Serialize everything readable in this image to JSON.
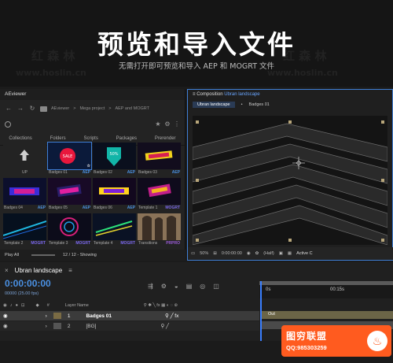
{
  "hero": {
    "title": "预览和导入文件",
    "subtitle": "无需打开即可预览和导入 AEP 和 MOGRT 文件",
    "watermark_cn": "红 森 林",
    "watermark_url": "www.hoslin.cn"
  },
  "aeviewer": {
    "title": "AEviewer",
    "breadcrumb": [
      "AEviewer",
      "Mega project",
      "AEP and MOGRT"
    ],
    "breadcrumb_sep": ">",
    "tabs": [
      "Collections",
      "Folders",
      "Scripts",
      "Packages",
      "Prerender"
    ],
    "items": [
      {
        "label": "UP",
        "tag": ""
      },
      {
        "label": "Badges 01",
        "tag": "AEP"
      },
      {
        "label": "Badges 02",
        "tag": "AEP"
      },
      {
        "label": "Badges 03",
        "tag": "AEP"
      },
      {
        "label": "Badges 04",
        "tag": "AEP"
      },
      {
        "label": "Badges 05",
        "tag": "AEP"
      },
      {
        "label": "Badges 06",
        "tag": "AEP"
      },
      {
        "label": "Template 1",
        "tag": "MOGRT"
      },
      {
        "label": "Template 2",
        "tag": "MOGRT"
      },
      {
        "label": "Template 3",
        "tag": "MOGRT"
      },
      {
        "label": "Template 4",
        "tag": "MOGRT"
      },
      {
        "label": "Transitions",
        "tag": "PRPRO"
      }
    ],
    "footer": {
      "play_all": "Play All",
      "count": "12 / 12 - Showing"
    }
  },
  "composition": {
    "title_prefix": "Composition",
    "title_name": "Ubran landscape",
    "menu_icon": "≡",
    "tabs": [
      "Ubran landscape",
      "Badges 01"
    ],
    "tab_sep": "•",
    "toolbar": {
      "zoom": "50%",
      "timecode": "0:00:00:00",
      "quality": "(Half)",
      "camera": "Active C"
    }
  },
  "timeline": {
    "comp_name": "Ubran landscape",
    "menu_icon": "≡",
    "close_icon": "×",
    "timecode": "0:00:00:00",
    "fps": "00000 (25.00 fps)",
    "ruler": [
      "0s",
      "00:15s"
    ],
    "layer_header": {
      "num": "#",
      "name": "Layer Name"
    },
    "layers": [
      {
        "num": "1",
        "name": "Badges 01",
        "color": "#7a6b44"
      },
      {
        "num": "2",
        "name": "[BG]",
        "color": "#555555"
      }
    ],
    "out_tag": "Out"
  },
  "badge": {
    "title": "图穷联盟",
    "qq": "QQ:985303259",
    "logo": "♨"
  },
  "colors": {
    "accent": "#3f7fd6",
    "badge": "#ff5b1f",
    "tag_aep": "#4a90e2",
    "tag_mogrt": "#7b68ee"
  }
}
